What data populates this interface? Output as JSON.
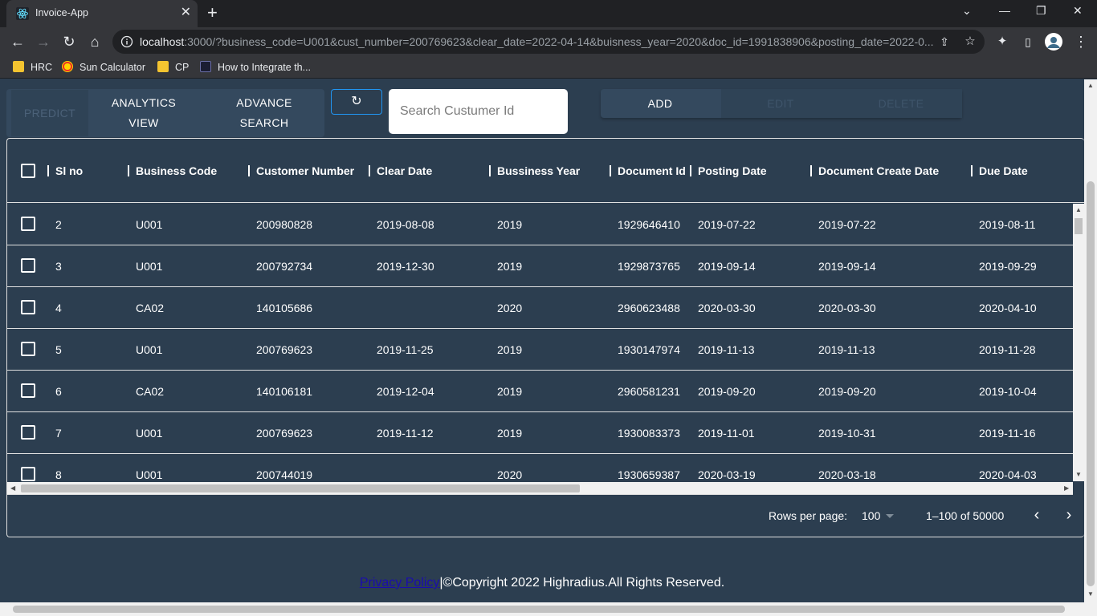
{
  "browser": {
    "tab_title": "Invoice-App",
    "url_host": "localhost",
    "url_rest": ":3000/?business_code=U001&cust_number=200769623&clear_date=2022-04-14&buisness_year=2020&doc_id=1991838906&posting_date=2022-0...",
    "bookmarks": [
      "HRC",
      "Sun Calculator",
      "CP",
      "How to Integrate th..."
    ]
  },
  "toolbar": {
    "predict": "PREDICT",
    "analytics_line1": "ANALYTICS",
    "analytics_line2": "VIEW",
    "advance_line1": "ADVANCE",
    "advance_line2": "SEARCH",
    "search_placeholder": "Search Custumer Id",
    "add": "ADD",
    "edit": "EDIT",
    "delete": "DELETE"
  },
  "table": {
    "columns": [
      "Sl no",
      "Business Code",
      "Customer Number",
      "Clear Date",
      "Bussiness Year",
      "Document Id",
      "Posting Date",
      "Document Create Date",
      "Due Date"
    ],
    "rows": [
      [
        "2",
        "U001",
        "200980828",
        "2019-08-08",
        "2019",
        "1929646410",
        "2019-07-22",
        "2019-07-22",
        "2019-08-11"
      ],
      [
        "3",
        "U001",
        "200792734",
        "2019-12-30",
        "2019",
        "1929873765",
        "2019-09-14",
        "2019-09-14",
        "2019-09-29"
      ],
      [
        "4",
        "CA02",
        "140105686",
        "",
        "2020",
        "2960623488",
        "2020-03-30",
        "2020-03-30",
        "2020-04-10"
      ],
      [
        "5",
        "U001",
        "200769623",
        "2019-11-25",
        "2019",
        "1930147974",
        "2019-11-13",
        "2019-11-13",
        "2019-11-28"
      ],
      [
        "6",
        "CA02",
        "140106181",
        "2019-12-04",
        "2019",
        "2960581231",
        "2019-09-20",
        "2019-09-20",
        "2019-10-04"
      ],
      [
        "7",
        "U001",
        "200769623",
        "2019-11-12",
        "2019",
        "1930083373",
        "2019-11-01",
        "2019-10-31",
        "2019-11-16"
      ],
      [
        "8",
        "U001",
        "200744019",
        "",
        "2020",
        "1930659387",
        "2020-03-19",
        "2020-03-18",
        "2020-04-03"
      ]
    ]
  },
  "pagination": {
    "rows_per_page_label": "Rows per page:",
    "rows_per_page_value": "100",
    "range": "1–100 of 50000"
  },
  "footer": {
    "link": "Privacy Policy",
    "text": "|©Copyright 2022 Highradius.All Rights Reserved."
  }
}
